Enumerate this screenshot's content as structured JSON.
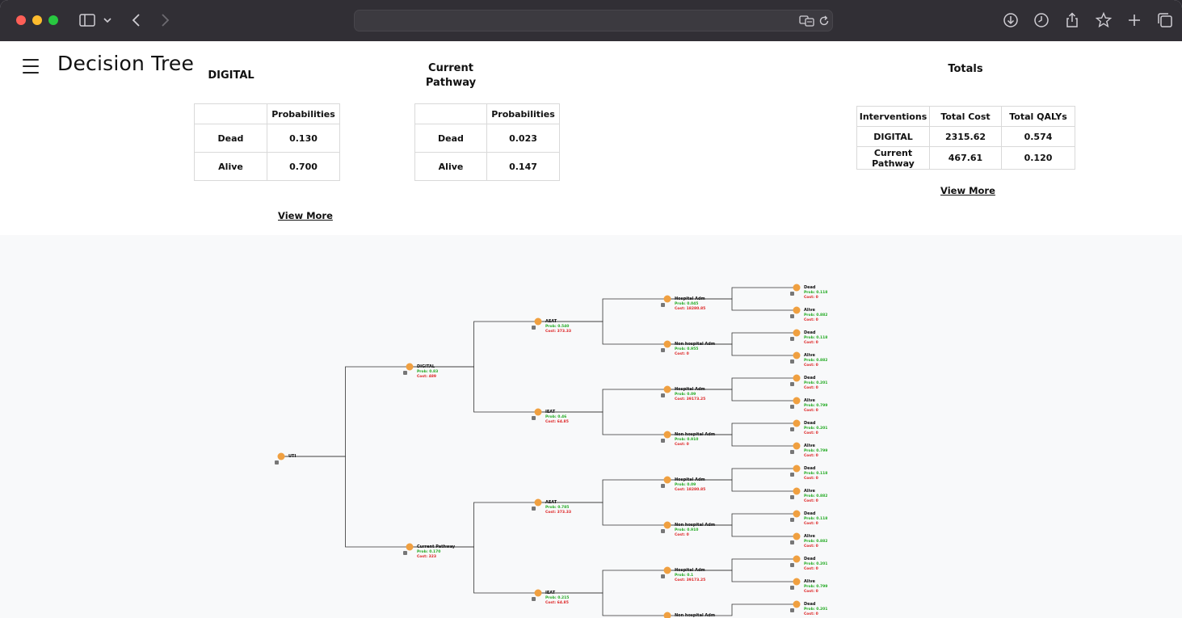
{
  "browser": {
    "url": ""
  },
  "header": {
    "title": "Decision Tree"
  },
  "digital_panel": {
    "title": "DIGITAL",
    "column_header": "Probabilities",
    "rows": [
      {
        "label": "Dead",
        "value": "0.130"
      },
      {
        "label": "Alive",
        "value": "0.700"
      }
    ],
    "view_more": "View More"
  },
  "current_panel": {
    "title_line1": "Current",
    "title_line2": "Pathway",
    "column_header": "Probabilities",
    "rows": [
      {
        "label": "Dead",
        "value": "0.023"
      },
      {
        "label": "Alive",
        "value": "0.147"
      }
    ]
  },
  "totals_panel": {
    "title": "Totals",
    "headers": [
      "Interventions",
      "Total Cost",
      "Total QALYs"
    ],
    "rows": [
      {
        "label": "DIGITAL",
        "cost": "2315.62",
        "qalys": "0.574"
      },
      {
        "label_line1": "Current",
        "label_line2": "Pathway",
        "cost": "467.61",
        "qalys": "0.120"
      }
    ],
    "view_more": "View More"
  },
  "tree": {
    "colors": {
      "node": "#f0a040",
      "prob": "#22aa22",
      "cost": "#dd2222",
      "link": "#333333"
    },
    "root": {
      "name": "UTI"
    },
    "level1": [
      {
        "name": "DIGITAL",
        "prob": "Prob: 0.83",
        "cost": "Cost: 489"
      },
      {
        "name": "Current Pathway",
        "prob": "Prob: 0.170",
        "cost": "Cost: 323"
      }
    ],
    "level2": [
      {
        "name": "AEAT",
        "prob": "Prob: 0.540",
        "cost": "Cost: 373.33"
      },
      {
        "name": "IEAT",
        "prob": "Prob: 0.46",
        "cost": "Cost: 64.85"
      },
      {
        "name": "AEAT",
        "prob": "Prob: 0.785",
        "cost": "Cost: 373.33"
      },
      {
        "name": "IEAT",
        "prob": "Prob: 0.215",
        "cost": "Cost: 64.85"
      }
    ],
    "level3": [
      {
        "name": "Hospital Adm",
        "prob": "Prob: 0.045",
        "cost": "Cost: 18280.85"
      },
      {
        "name": "Non hospital Adm",
        "prob": "Prob: 0.955",
        "cost": "Cost: 0"
      },
      {
        "name": "Hospital Adm",
        "prob": "Prob: 0.09",
        "cost": "Cost: 39173.25"
      },
      {
        "name": "Non hospital Adm",
        "prob": "Prob: 0.910",
        "cost": "Cost: 0"
      },
      {
        "name": "Hospital Adm",
        "prob": "Prob: 0.09",
        "cost": "Cost: 18280.85"
      },
      {
        "name": "Non hospital Adm",
        "prob": "Prob: 0.910",
        "cost": "Cost: 0"
      },
      {
        "name": "Hospital Adm",
        "prob": "Prob: 0.1",
        "cost": "Cost: 39173.25"
      },
      {
        "name": "Non hospital Adm",
        "prob": "Prob: 0.9",
        "cost": ""
      }
    ],
    "level4": [
      {
        "name": "Dead",
        "prob": "Prob: 0.118",
        "cost": "Cost: 0"
      },
      {
        "name": "Alive",
        "prob": "Prob: 0.882",
        "cost": "Cost: 0"
      },
      {
        "name": "Dead",
        "prob": "Prob: 0.118",
        "cost": "Cost: 0"
      },
      {
        "name": "Alive",
        "prob": "Prob: 0.882",
        "cost": "Cost: 0"
      },
      {
        "name": "Dead",
        "prob": "Prob: 0.201",
        "cost": "Cost: 0"
      },
      {
        "name": "Alive",
        "prob": "Prob: 0.799",
        "cost": "Cost: 0"
      },
      {
        "name": "Dead",
        "prob": "Prob: 0.201",
        "cost": "Cost: 0"
      },
      {
        "name": "Alive",
        "prob": "Prob: 0.799",
        "cost": "Cost: 0"
      },
      {
        "name": "Dead",
        "prob": "Prob: 0.118",
        "cost": "Cost: 0"
      },
      {
        "name": "Alive",
        "prob": "Prob: 0.882",
        "cost": "Cost: 0"
      },
      {
        "name": "Dead",
        "prob": "Prob: 0.118",
        "cost": "Cost: 0"
      },
      {
        "name": "Alive",
        "prob": "Prob: 0.882",
        "cost": "Cost: 0"
      },
      {
        "name": "Dead",
        "prob": "Prob: 0.201",
        "cost": "Cost: 0"
      },
      {
        "name": "Alive",
        "prob": "Prob: 0.799",
        "cost": "Cost: 0"
      },
      {
        "name": "Dead",
        "prob": "Prob: 0.201",
        "cost": "Cost: 0"
      }
    ]
  }
}
